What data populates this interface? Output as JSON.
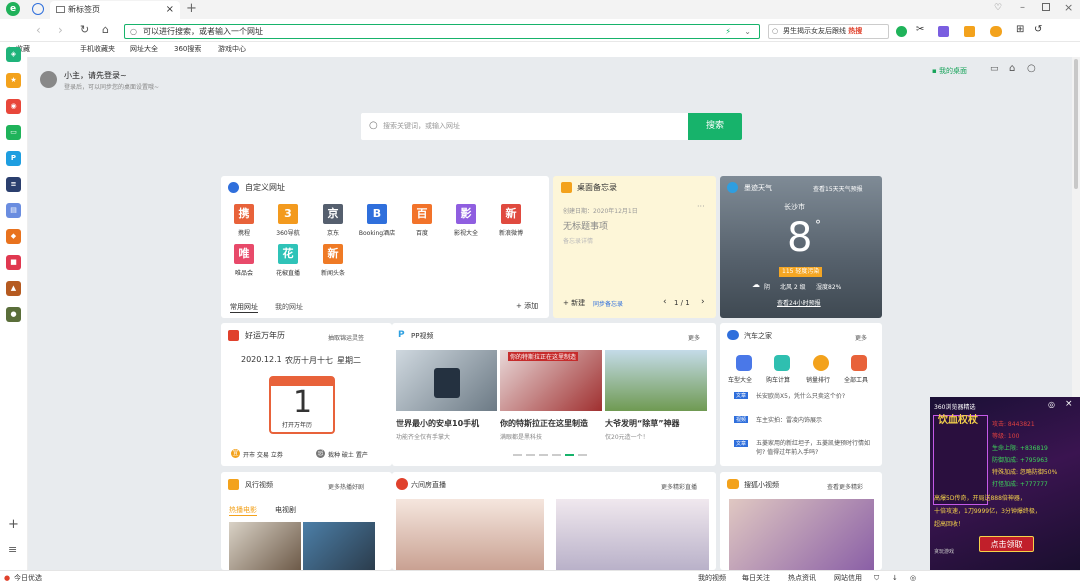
{
  "tab": {
    "title": "新标签页"
  },
  "address": {
    "placeholder": "可以进行搜索，或者输入一个网址"
  },
  "top_search": {
    "text": "男生揭示女友后跟线",
    "badge": "热搜"
  },
  "bookmarks": [
    {
      "label": "收藏"
    },
    {
      "label": "手机收藏夹"
    },
    {
      "label": "网址大全"
    },
    {
      "label": "360搜索"
    },
    {
      "label": "游戏中心"
    }
  ],
  "user": {
    "greet": "小主，请先登录~",
    "sub": "登录后，可以同步您的桌面设置哦~"
  },
  "my_desktop": "我的桌面",
  "main_search": {
    "placeholder": "搜索关键词，或输入网址",
    "button": "搜索"
  },
  "custom_sites": {
    "title": "自定义网址",
    "tabs": [
      "常用网址",
      "我的网址"
    ],
    "add": "添加",
    "tiles": [
      {
        "char": "携",
        "label": "携程",
        "color": "#e8623a"
      },
      {
        "char": "3",
        "label": "360导航",
        "color": "#f39a1e"
      },
      {
        "char": "京",
        "label": "京东",
        "color": "#555f6e"
      },
      {
        "char": "B",
        "label": "Booking酒店",
        "color": "#2f6fdc"
      },
      {
        "char": "百",
        "label": "百度",
        "color": "#f2732a"
      },
      {
        "char": "影",
        "label": "影视大全",
        "color": "#8f5ee0"
      },
      {
        "char": "新",
        "label": "新浪微博",
        "color": "#e04a3f"
      },
      {
        "char": "唯",
        "label": "唯品会",
        "color": "#e84a6a"
      },
      {
        "char": "花",
        "label": "花椒直播",
        "color": "#2fc3b8"
      },
      {
        "char": "新",
        "label": "新闻头条",
        "color": "#ef7a25"
      }
    ]
  },
  "memo": {
    "title": "桌面备忘录",
    "date": "创建日期：2020年12月1日",
    "entry": "无标题事项",
    "detail": "备忘录详情",
    "new": "新建",
    "sync": "同步备忘录",
    "page": "1 / 1"
  },
  "weather": {
    "title": "墨迹天气",
    "forecast": "查看15天天气预报",
    "city": "长沙市",
    "temp": "8",
    "aqi": "115 轻度污染",
    "cond": "阴",
    "wind": "北风 2 级",
    "humidity": "湿度82%",
    "hourly": "查看24小时预报"
  },
  "calendar": {
    "title": "好运万年历",
    "link": "抽取锦运灵签",
    "date": "2020.12.1",
    "lunar": "农历十月十七",
    "weekday": "星期二",
    "day": "1",
    "open": "打开万年历",
    "yi_label": "宜",
    "yi": "开市 交易 立券",
    "ji_label": "忌",
    "ji": "栽种 破土 置产"
  },
  "pp_video": {
    "title": "PP视频",
    "more": "更多",
    "items": [
      {
        "cap": "你的特斯拉正在这里制造",
        "title": "世界最小的安卓10手机",
        "sub": "功能齐全仅有手掌大"
      },
      {
        "cap": "你的特斯拉正在这里制造",
        "title": "你的特斯拉正在这里制造",
        "sub": "满眼都是黑科技"
      },
      {
        "cap": "",
        "title": "大爷发明“除草”神器",
        "sub": "仅20元造一个！"
      }
    ]
  },
  "autohome": {
    "title": "汽车之家",
    "more": "更多",
    "icons": [
      "车型大全",
      "购车计算",
      "销量排行",
      "全部工具"
    ],
    "news": [
      {
        "tag": "文章",
        "text": "长安欧尚X5，凭什么只卖这个价?"
      },
      {
        "tag": "视频",
        "text": "车主实拍：雷凌内饰展示"
      },
      {
        "tag": "文章",
        "text": "五菱家用的新红坦子，五菱凯捷预时行情如何? 值得过年前入手吗?"
      }
    ]
  },
  "fengxing": {
    "title": "风行视频",
    "link": "更多热播好剧",
    "tabs": [
      "热播电影",
      "电视剧"
    ]
  },
  "liujian": {
    "title": "六间房直播",
    "more": "更多精彩直播"
  },
  "sohu": {
    "title": "搜狐小视频",
    "more": "查看更多精彩"
  },
  "ad": {
    "title": "360浏览器精选",
    "game": "饮血权杖",
    "lines": [
      "攻击: 8443821",
      "等级: 100",
      "生命上限: +836819",
      "防御加成: +795963",
      "特殊加成: 忽略防御50%",
      "打怪加成: +777777"
    ],
    "promo1": "高爆5D传奇，开局送888倍神器，",
    "promo2": "十倍攻速，1刀9999亿，3分钟爆终极，",
    "promo3": "超高回收！",
    "cta": "点击领取",
    "source": "贪玩游戏",
    "tag": "广告"
  },
  "footer": {
    "left": "今日优选",
    "items": [
      "我的视频",
      "每日关注",
      "热点资讯",
      "网站信用"
    ]
  }
}
